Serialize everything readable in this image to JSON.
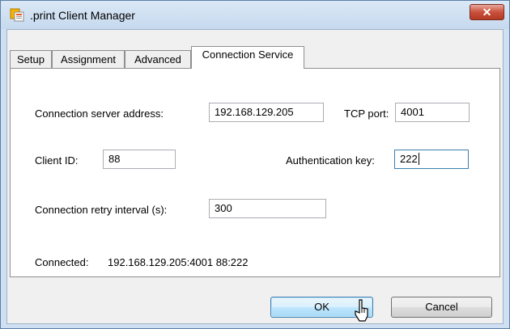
{
  "window": {
    "title": ".print Client Manager",
    "close_symbol": "✕",
    "icon": "print-app-icon"
  },
  "tabs": [
    {
      "label": "Setup",
      "active": false
    },
    {
      "label": "Assignment",
      "active": false
    },
    {
      "label": "Advanced",
      "active": false
    },
    {
      "label": "Connection Service",
      "active": true
    }
  ],
  "form": {
    "server_address_label": "Connection server address:",
    "server_address_value": "192.168.129.205",
    "tcp_port_label": "TCP port:",
    "tcp_port_value": "4001",
    "client_id_label": "Client ID:",
    "client_id_value": "88",
    "auth_key_label": "Authentication key:",
    "auth_key_value": "222",
    "retry_interval_label": "Connection retry interval (s):",
    "retry_interval_value": "300",
    "status_label": "Connected:",
    "status_value": "192.168.129.205:4001 88:222"
  },
  "buttons": {
    "ok_label": "OK",
    "cancel_label": "Cancel"
  },
  "colors": {
    "accent": "#3c7fb1",
    "close": "#c9503c"
  }
}
